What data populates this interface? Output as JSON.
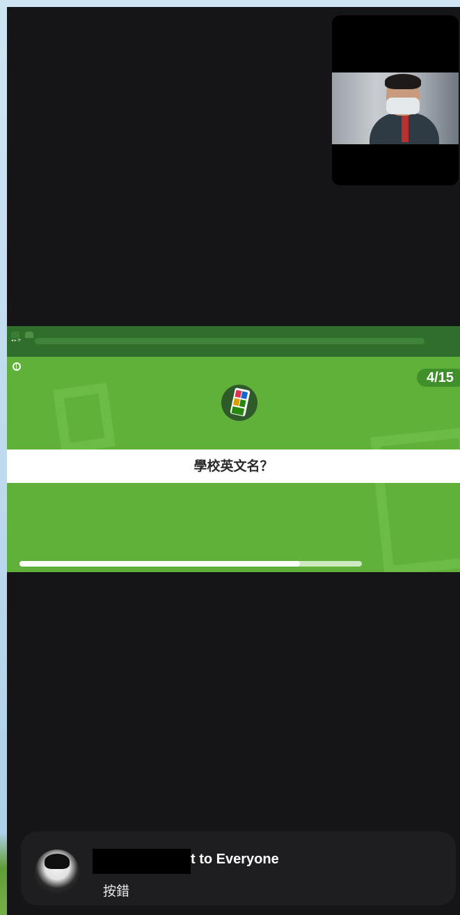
{
  "screen_share": {
    "browser": {
      "tabs": [
        "",
        ""
      ],
      "url": "",
      "bookmarks": [
        "",
        "",
        "",
        ""
      ]
    },
    "counter": "4/15",
    "question": "學校英文名？",
    "timer_progress": 0.82
  },
  "participant_tile": {
    "camera_on": true
  },
  "chat_toast": {
    "sender_name_redacted": true,
    "sender_suffix": "t to Everyone",
    "message": "按錯"
  },
  "colors": {
    "call_background": "#151517",
    "quiz_green": "#5fb13a",
    "counter_badge": "#3f8f2a",
    "toast_background": "#1e1e21"
  },
  "icons": [
    "globe-icon",
    "quiz-logo-icon",
    "avatar"
  ]
}
